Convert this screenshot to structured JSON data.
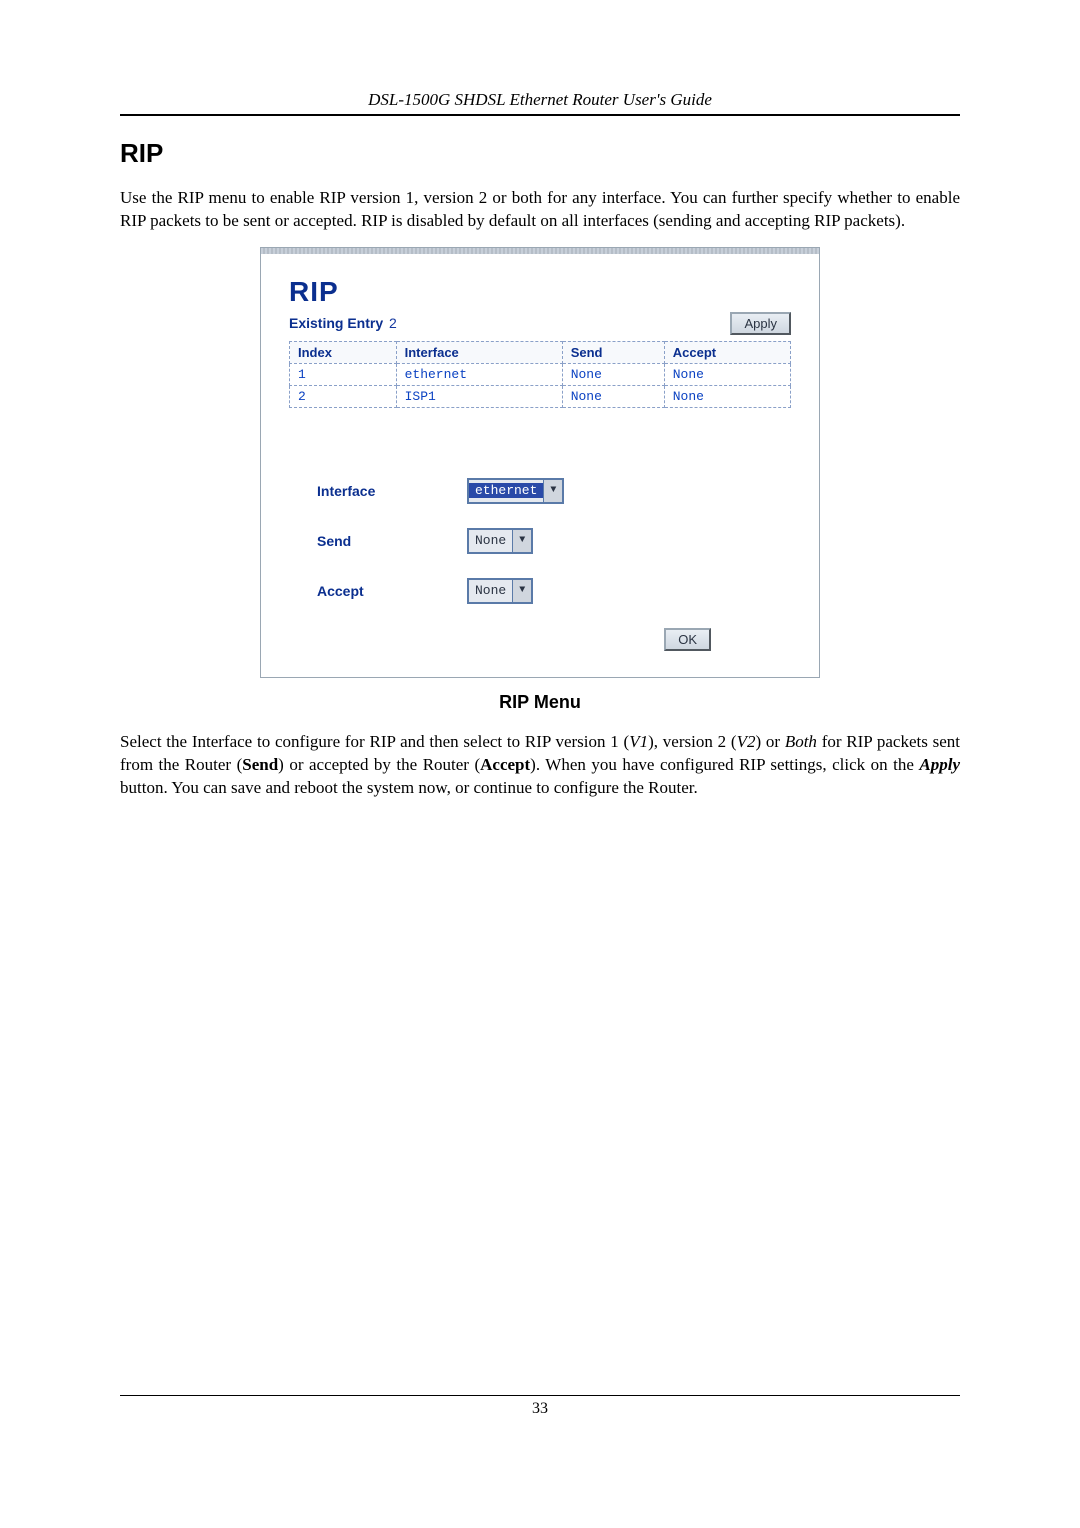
{
  "doc": {
    "running_head": "DSL-1500G SHDSL Ethernet Router User's Guide",
    "page_number": "33"
  },
  "section": {
    "title": "RIP",
    "intro": "Use the RIP menu to enable RIP version 1, version 2 or both for any interface. You can further specify whether to enable RIP packets to be sent or accepted. RIP is disabled by default on all interfaces (sending and accepting RIP packets).",
    "figure_caption": "RIP Menu",
    "outro_1": "Select the Interface to configure for RIP and then select to RIP version 1 (",
    "outro_v1": "V1",
    "outro_2": "), version 2 (",
    "outro_v2": "V2",
    "outro_3": ") or ",
    "outro_both": "Both",
    "outro_4": " for RIP packets sent from the Router (",
    "outro_send": "Send",
    "outro_5": ") or accepted by the Router (",
    "outro_accept": "Accept",
    "outro_6": "). When you have configured RIP settings, click on the ",
    "outro_apply": "Apply",
    "outro_7": " button. You can save and reboot the system now, or continue to configure the Router."
  },
  "panel": {
    "heading": "RIP",
    "existing_label": "Existing Entry",
    "existing_count": "2",
    "apply_label": "Apply",
    "ok_label": "OK",
    "columns": {
      "index": "Index",
      "interface": "Interface",
      "send": "Send",
      "accept": "Accept"
    },
    "rows": [
      {
        "index": "1",
        "interface": "ethernet",
        "send": "None",
        "accept": "None"
      },
      {
        "index": "2",
        "interface": "ISP1",
        "send": "None",
        "accept": "None"
      }
    ],
    "form": {
      "interface_label": "Interface",
      "send_label": "Send",
      "accept_label": "Accept",
      "interface_value": "ethernet",
      "send_value": "None",
      "accept_value": "None"
    }
  }
}
